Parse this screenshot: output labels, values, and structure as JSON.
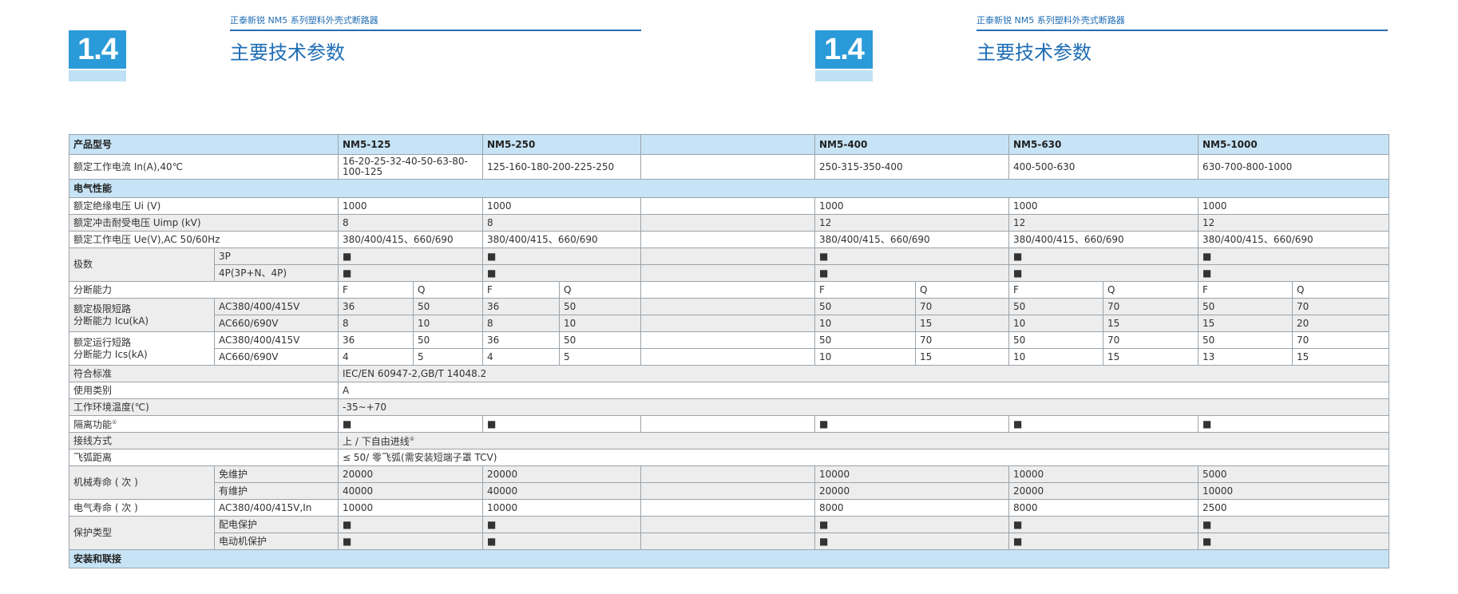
{
  "header": {
    "series_label": "正泰新锐 NM5 系列塑料外壳式断路器",
    "section_number": "1.4",
    "title": "主要技术参数"
  },
  "table": {
    "model_label": "产品型号",
    "models": [
      "NM5-125",
      "NM5-250",
      "NM5-400",
      "NM5-630",
      "NM5-1000"
    ],
    "rated_current": {
      "label": "额定工作电流 In(A),40℃",
      "values": [
        "16-20-25-32-40-50-63-80-100-125",
        "125-160-180-200-225-250",
        "250-315-350-400",
        "400-500-630",
        "630-700-800-1000"
      ]
    },
    "section_electrical": "电气性能",
    "ui": {
      "label": "额定绝缘电压 Ui (V)",
      "values": [
        "1000",
        "1000",
        "1000",
        "1000",
        "1000"
      ]
    },
    "uimp": {
      "label": "额定冲击耐受电压 Uimp (kV)",
      "values": [
        "8",
        "8",
        "12",
        "12",
        "12"
      ]
    },
    "ue": {
      "label": "额定工作电压 Ue(V),AC 50/60Hz",
      "values": [
        "380/400/415、660/690",
        "380/400/415、660/690",
        "380/400/415、660/690",
        "380/400/415、660/690",
        "380/400/415、660/690"
      ]
    },
    "poles": {
      "label": "极数",
      "sub": [
        "3P",
        "4P(3P+N、4P)"
      ],
      "mark": "■"
    },
    "breaking": {
      "label": "分断能力",
      "levels": [
        "F",
        "Q"
      ]
    },
    "icu": {
      "label_line1": "额定极限短路",
      "label_line2": "分断能力 Icu(kA)",
      "rows": [
        {
          "voltage": "AC380/400/415V",
          "values": [
            "36",
            "50",
            "36",
            "50",
            "50",
            "70",
            "50",
            "70",
            "50",
            "70"
          ]
        },
        {
          "voltage": "AC660/690V",
          "values": [
            "8",
            "10",
            "8",
            "10",
            "10",
            "15",
            "10",
            "15",
            "15",
            "20"
          ]
        }
      ]
    },
    "ics": {
      "label_line1": "额定运行短路",
      "label_line2": "分断能力 Ics(kA)",
      "rows": [
        {
          "voltage": "AC380/400/415V",
          "values": [
            "36",
            "50",
            "36",
            "50",
            "50",
            "70",
            "50",
            "70",
            "50",
            "70"
          ]
        },
        {
          "voltage": "AC660/690V",
          "values": [
            "4",
            "5",
            "4",
            "5",
            "10",
            "15",
            "10",
            "15",
            "13",
            "15"
          ]
        }
      ]
    },
    "standard": {
      "label": "符合标准",
      "value": "IEC/EN 60947-2,GB/T 14048.2"
    },
    "category": {
      "label": "使用类别",
      "value": "A"
    },
    "temperature": {
      "label": "工作环境温度(℃)",
      "value": "-35~+70"
    },
    "isolation": {
      "label": "隔离功能",
      "note": "①"
    },
    "wiring": {
      "label": "接线方式",
      "value": "上 / 下自由进线",
      "note": "②"
    },
    "arc": {
      "label": "飞弧距离",
      "value": "≤ 50/ 零飞弧(需安装短端子罩 TCV)"
    },
    "mech_life": {
      "label": "机械寿命 ( 次 )",
      "rows": [
        {
          "sub": "免维护",
          "values": [
            "20000",
            "20000",
            "10000",
            "10000",
            "5000"
          ]
        },
        {
          "sub": "有维护",
          "values": [
            "40000",
            "40000",
            "20000",
            "20000",
            "10000"
          ]
        }
      ]
    },
    "elec_life": {
      "label": "电气寿命 ( 次 )",
      "sub": "AC380/400/415V,In",
      "values": [
        "10000",
        "10000",
        "8000",
        "8000",
        "2500"
      ]
    },
    "protection": {
      "label": "保护类型",
      "sub": [
        "配电保护",
        "电动机保护"
      ]
    },
    "section_install": "安装和联接"
  },
  "colors": {
    "accent": "#2b9ad8",
    "title_blue": "#1f6db5",
    "header_fill": "#c7e4f6",
    "stripe": "#ededed"
  }
}
